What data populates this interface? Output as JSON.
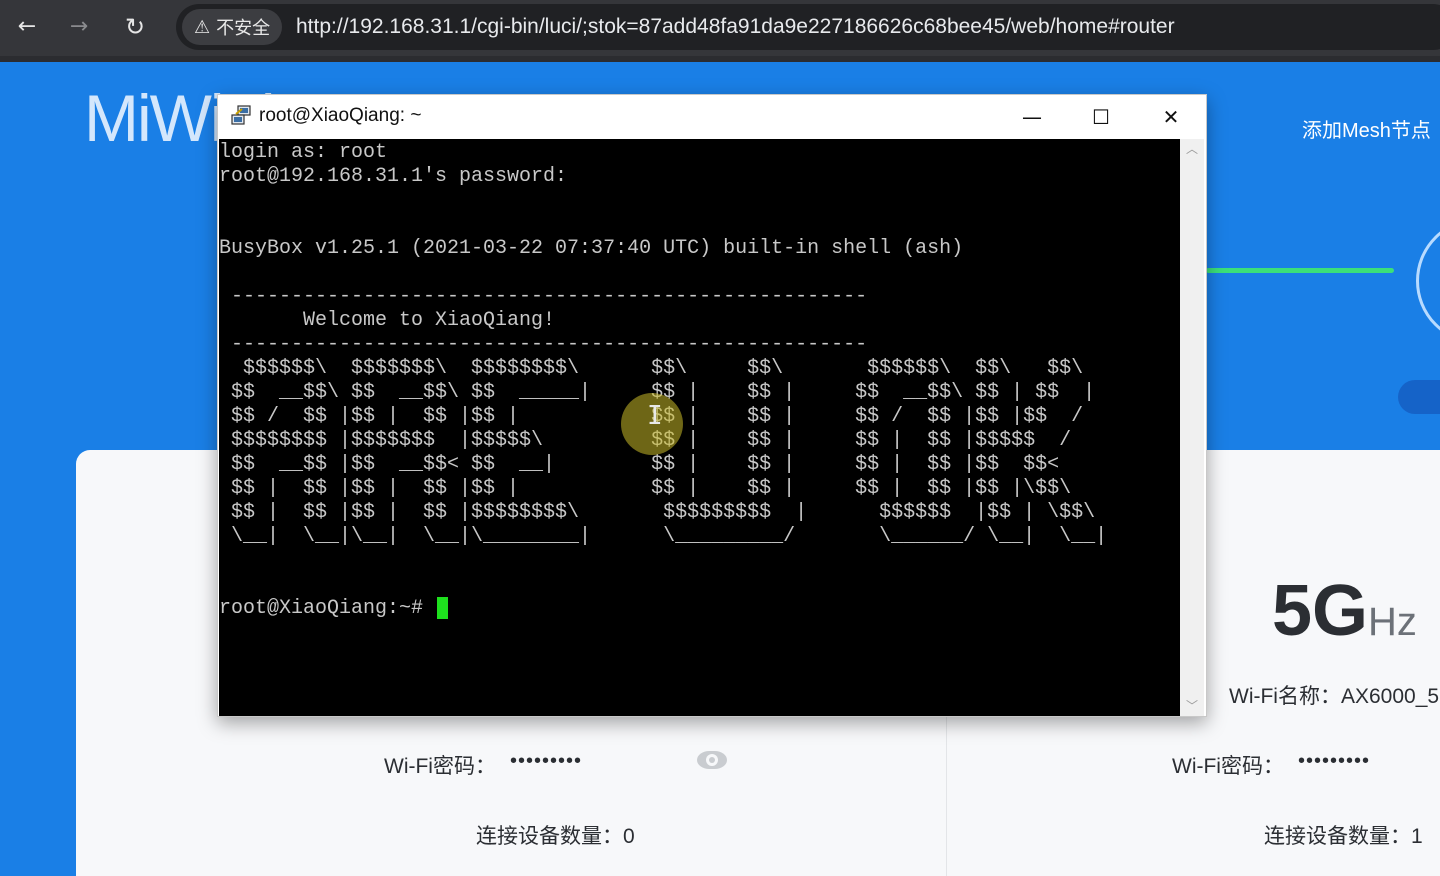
{
  "browser": {
    "security_label": "不安全",
    "url": "http://192.168.31.1/cgi-bin/luci/;stok=87add48fa91da9e227186626c68bee45/web/home#router",
    "icons": [
      "back-arrow-icon",
      "forward-arrow-icon",
      "reload-icon",
      "warning-triangle-icon"
    ]
  },
  "router_page": {
    "logo_text": "MiWiFi",
    "mesh_link": "添加Mesh节点",
    "band_5g": {
      "big": "5G",
      "unit": "Hz"
    },
    "wifi_name": "Wi-Fi名称：AX6000_5",
    "left_password_label": "Wi-Fi密码：",
    "left_password_value": "•••••••••",
    "right_password_label": "Wi-Fi密码：",
    "right_password_value": "•••••••••",
    "left_devices": "连接设备数量：0",
    "right_devices": "连接设备数量：1"
  },
  "terminal": {
    "title": "root@XiaoQiang: ~",
    "controls": {
      "minimize": "—",
      "maximize": "☐",
      "close": "✕"
    },
    "lines": [
      "login as: root",
      "root@192.168.31.1's password:",
      "",
      "",
      "BusyBox v1.25.1 (2021-03-22 07:37:40 UTC) built-in shell (ash)",
      "",
      " -----------------------------------------------------",
      "       Welcome to XiaoQiang!",
      " -----------------------------------------------------",
      "  $$$$$$\\  $$$$$$$\\  $$$$$$$$\\      $$\\     $$\\       $$$$$$\\  $$\\   $$\\",
      " $$  __$$\\ $$  __$$\\ $$  _____|     $$ |    $$ |     $$  __$$\\ $$ | $$  |",
      " $$ /  $$ |$$ |  $$ |$$ |           $$ |    $$ |     $$ /  $$ |$$ |$$  /",
      " $$$$$$$$ |$$$$$$$  |$$$$$\\         $$ |    $$ |     $$ |  $$ |$$$$$  /",
      " $$  __$$ |$$  __$$< $$  __|        $$ |    $$ |     $$ |  $$ |$$  $$<",
      " $$ |  $$ |$$ |  $$ |$$ |           $$ |    $$ |     $$ |  $$ |$$ |\\$$\\",
      " $$ |  $$ |$$ |  $$ |$$$$$$$$\\       $$$$$$$$$  |      $$$$$$  |$$ | \\$$\\",
      " \\__|  \\__|\\__|  \\__|\\________|      \\_________/       \\______/ \\__|  \\__|",
      "",
      "",
      "root@XiaoQiang:~# "
    ]
  }
}
